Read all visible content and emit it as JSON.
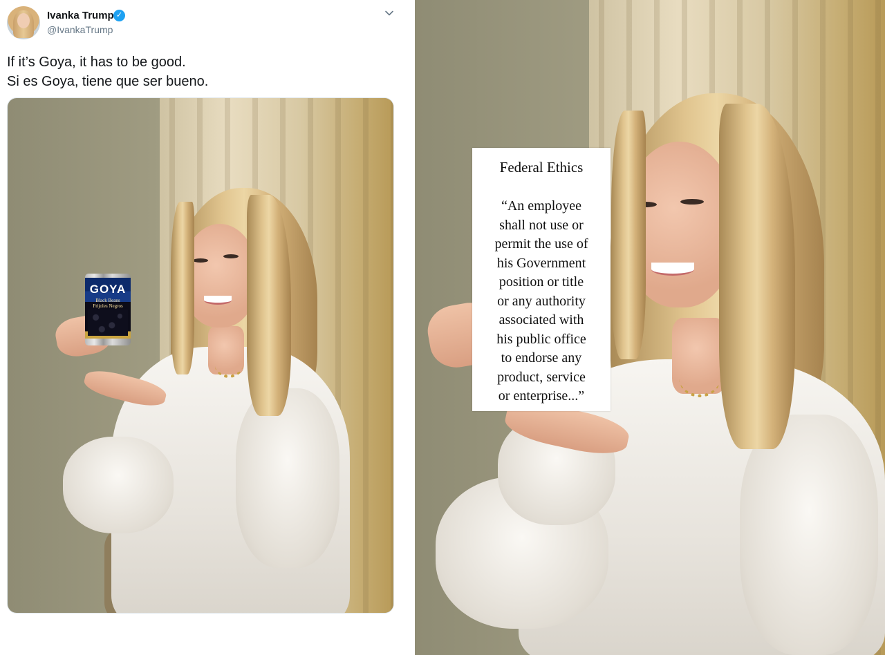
{
  "tweet": {
    "display_name": "Ivanka Trump",
    "handle": "@IvankaTrump",
    "text_lines": [
      "If it’s Goya, it has to be good.",
      "Si es Goya, tiene que ser bueno."
    ],
    "can": {
      "brand": "GOYA",
      "label_lines": [
        "Black Beans",
        "Frijoles Negros"
      ]
    }
  },
  "meme": {
    "sign_title": "Federal Ethics",
    "quote_lines": [
      "“An employee",
      "shall not use or",
      "permit the use of",
      "his Government",
      "position or title",
      "or any authority",
      "associated with",
      "his public office",
      "to endorse any",
      "product, service",
      "or enterprise...”"
    ]
  },
  "colors": {
    "verified_badge": "#1da1f2",
    "handle_gray": "#657786",
    "text_dark": "#14171a"
  },
  "icons": [
    "verified-badge-icon",
    "chevron-down-icon"
  ]
}
